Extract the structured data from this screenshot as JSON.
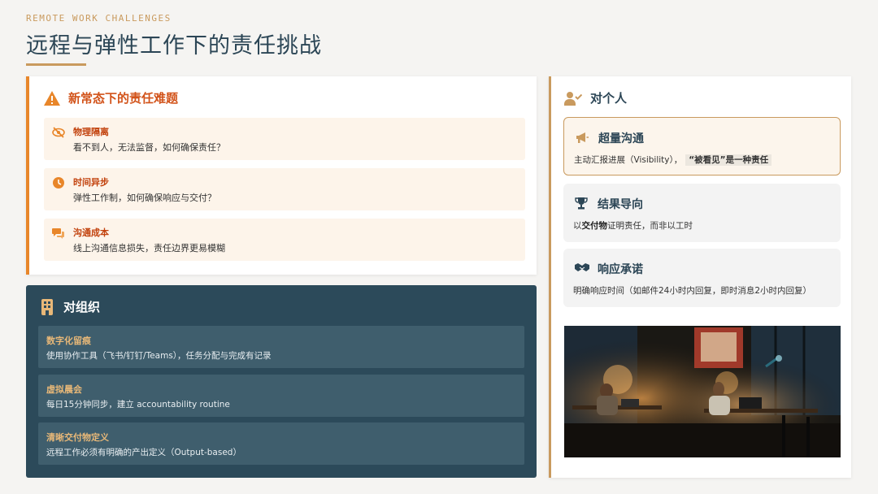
{
  "header": {
    "eyebrow": "REMOTE WORK CHALLENGES",
    "title": "远程与弹性工作下的责任挑战"
  },
  "challenges": {
    "title": "新常态下的责任难题",
    "items": [
      {
        "icon": "eye-slash-icon",
        "title": "物理隔离",
        "desc": "看不到人，无法监督，如何确保责任？"
      },
      {
        "icon": "clock-icon",
        "title": "时间异步",
        "desc": "弹性工作制，如何确保响应与交付？"
      },
      {
        "icon": "chat-bubbles-icon",
        "title": "沟通成本",
        "desc": "线上沟通信息损失，责任边界更易模糊"
      }
    ]
  },
  "organization": {
    "title": "对组织",
    "items": [
      {
        "title": "数字化留痕",
        "desc": "使用协作工具（飞书/钉钉/Teams），任务分配与完成有记录"
      },
      {
        "title": "虚拟晨会",
        "desc": "每日15分钟同步，建立 accountability routine"
      },
      {
        "title": "清晰交付物定义",
        "desc": "远程工作必须有明确的产出定义（Output-based）"
      }
    ]
  },
  "personal": {
    "title": "对个人",
    "items": [
      {
        "icon": "megaphone-icon",
        "title": "超量沟通",
        "desc_prefix": "主动汇报进展（Visibility），",
        "desc_tag": "“被看见”是一种责任"
      },
      {
        "icon": "trophy-icon",
        "title": "结果导向",
        "desc_a": "以",
        "desc_b": "交付物",
        "desc_c": "证明责任，而非以工时"
      },
      {
        "icon": "handshake-icon",
        "title": "响应承诺",
        "desc": "明确响应时间（如邮件24小时内回复，即时消息2小时内回复）"
      }
    ]
  },
  "colors": {
    "accent_gold": "#c99a5e",
    "accent_orange": "#e8862a",
    "navy": "#2c4656",
    "panel_dark": "#2c4a5a"
  }
}
